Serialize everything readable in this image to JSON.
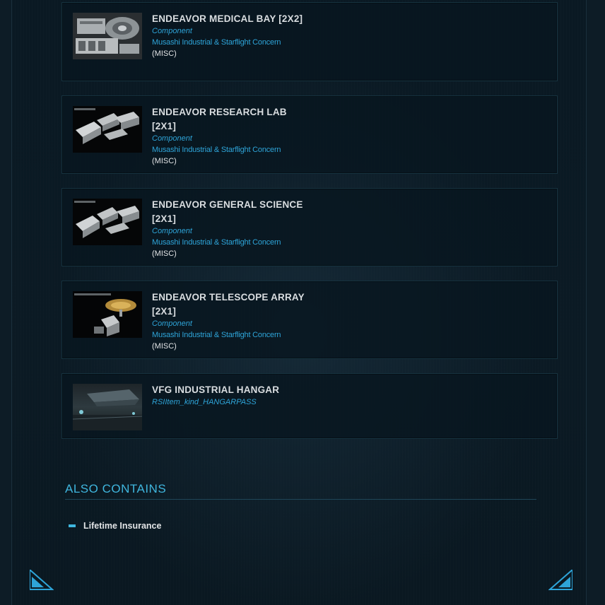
{
  "items": [
    {
      "title": "ENDEAVOR MEDICAL BAY [2X2]",
      "kind": "Component",
      "maker": "Musashi Industrial & Starflight Concern",
      "category": "(MISC)",
      "thumb_icon": "medical-bay-image"
    },
    {
      "title": "ENDEAVOR RESEARCH LAB [2X1]",
      "kind": "Component",
      "maker": "Musashi Industrial & Starflight Concern",
      "category": "(MISC)",
      "thumb_icon": "research-lab-image"
    },
    {
      "title": "ENDEAVOR GENERAL SCIENCE [2X1]",
      "kind": "Component",
      "maker": "Musashi Industrial & Starflight Concern",
      "category": "(MISC)",
      "thumb_icon": "general-science-image"
    },
    {
      "title": "ENDEAVOR TELESCOPE ARRAY [2X1]",
      "kind": "Component",
      "maker": "Musashi Industrial & Starflight Concern",
      "category": "(MISC)",
      "thumb_icon": "telescope-array-image"
    },
    {
      "title": "VFG INDUSTRIAL HANGAR",
      "kind": "RSIItem_kind_HANGARPASS",
      "thumb_icon": "hangar-image"
    }
  ],
  "also_contains": {
    "heading": "ALSO CONTAINS",
    "items": [
      "Lifetime Insurance"
    ]
  },
  "colors": {
    "accent": "#3fb6de",
    "link": "#2ea4d8",
    "background": "#0b1a24",
    "card_border": "#16323f"
  }
}
